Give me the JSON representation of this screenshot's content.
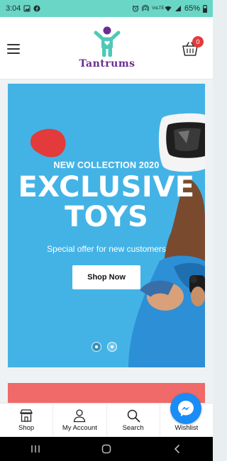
{
  "status_bar": {
    "time": "3:04",
    "network": "VoLTE",
    "battery": "65%"
  },
  "header": {
    "brand": "Tantrums",
    "cart_count": "0"
  },
  "hero": {
    "collection": "NEW COLLECTION 2020",
    "headline_line1": "EXCLUSIVE",
    "headline_line2": "TOYS",
    "offer": "Special offer for new customers",
    "cta": "Shop Now",
    "slides_total": 2,
    "active_slide": 2
  },
  "bottom_nav": {
    "items": [
      {
        "label": "Shop",
        "icon": "shop-icon"
      },
      {
        "label": "My Account",
        "icon": "account-icon"
      },
      {
        "label": "Search",
        "icon": "search-icon"
      },
      {
        "label": "Wishlist",
        "icon": "heart-icon"
      }
    ]
  },
  "colors": {
    "status_bar": "#6ad6c6",
    "hero_bg": "#43b3e6",
    "brand": "#6b2d8f",
    "accent_teal": "#4fc9b7",
    "badge": "#e33b3b",
    "messenger": "#1a8cf5",
    "second_banner": "#f06a6a"
  }
}
